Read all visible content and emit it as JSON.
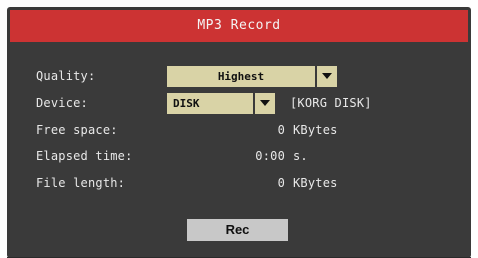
{
  "dialog": {
    "title": "MP3 Record"
  },
  "fields": {
    "quality_label": "Quality:",
    "quality_value": "Highest",
    "device_label": "Device:",
    "device_value": "DISK",
    "device_name": "[KORG DISK]",
    "free_space_label": "Free space:",
    "free_space_value": "0",
    "free_space_unit": "KBytes",
    "elapsed_label": "Elapsed time:",
    "elapsed_value": "0:00",
    "elapsed_unit": "s.",
    "file_length_label": "File length:",
    "file_length_value": "0",
    "file_length_unit": "KBytes"
  },
  "buttons": {
    "rec_label": "Rec"
  },
  "colors": {
    "title_bar": "#cc3333",
    "panel": "#3a3a3a",
    "select_bg": "#d9d3a6",
    "button_bg": "#c8c8c8"
  }
}
